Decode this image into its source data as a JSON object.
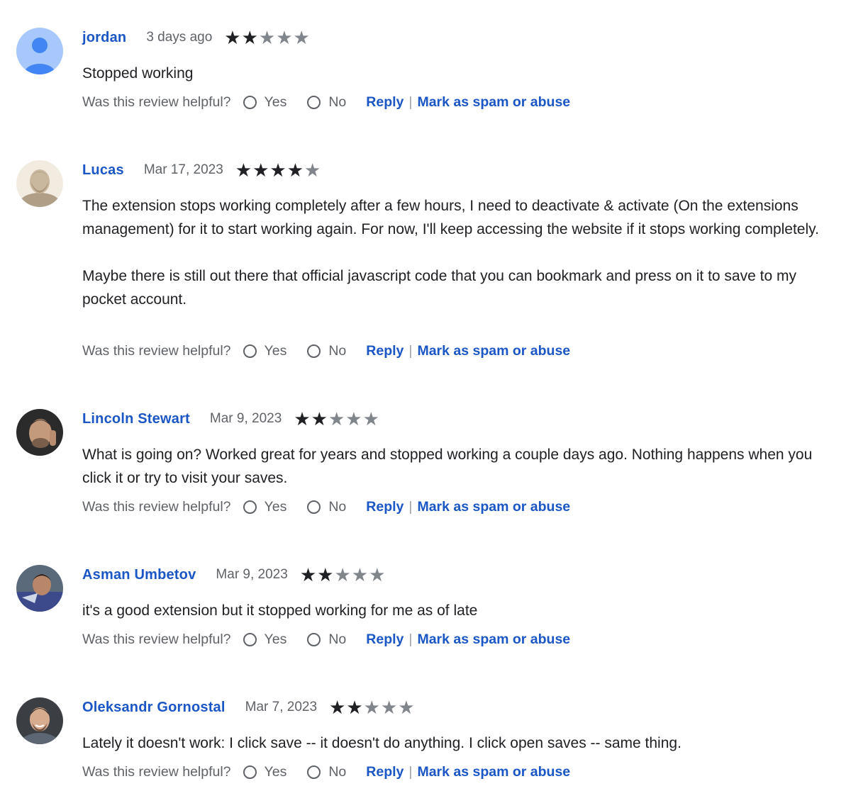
{
  "helpful_question": "Was this review helpful?",
  "yes_label": "Yes",
  "no_label": "No",
  "reply_label": "Reply",
  "separator": "|",
  "spam_label": "Mark as spam or abuse",
  "colors": {
    "link": "#1a56c6",
    "star_on": "#202124",
    "star_off": "#80868b"
  },
  "reviews": [
    {
      "author": "jordan",
      "date": "3 days ago",
      "rating": 2,
      "avatar": "default-user-icon",
      "paragraphs": [
        "Stopped working"
      ]
    },
    {
      "author": "Lucas",
      "date": "Mar 17, 2023",
      "rating": 4,
      "avatar": "statue-photo",
      "paragraphs": [
        "The extension stops working completely after a few hours, I need to deactivate & activate (On the extensions management) for it to start working again. For now, I'll keep accessing the website if it stops working completely.",
        "Maybe there is still out there that official javascript code that you can bookmark and press on it to save to my pocket account."
      ]
    },
    {
      "author": "Lincoln Stewart",
      "date": "Mar 9, 2023",
      "rating": 2,
      "avatar": "user-photo",
      "paragraphs": [
        "What is going on? Worked great for years and stopped working a couple days ago. Nothing happens when you click it or try to visit your saves."
      ]
    },
    {
      "author": "Asman Umbetov",
      "date": "Mar 9, 2023",
      "rating": 2,
      "avatar": "user-photo",
      "paragraphs": [
        "it's a good extension but it stopped working for me as of late"
      ]
    },
    {
      "author": "Oleksandr Gornostal",
      "date": "Mar 7, 2023",
      "rating": 2,
      "avatar": "user-photo",
      "paragraphs": [
        "Lately it doesn't work: I click save -- it doesn't do anything. I click open saves  -- same thing."
      ]
    }
  ]
}
